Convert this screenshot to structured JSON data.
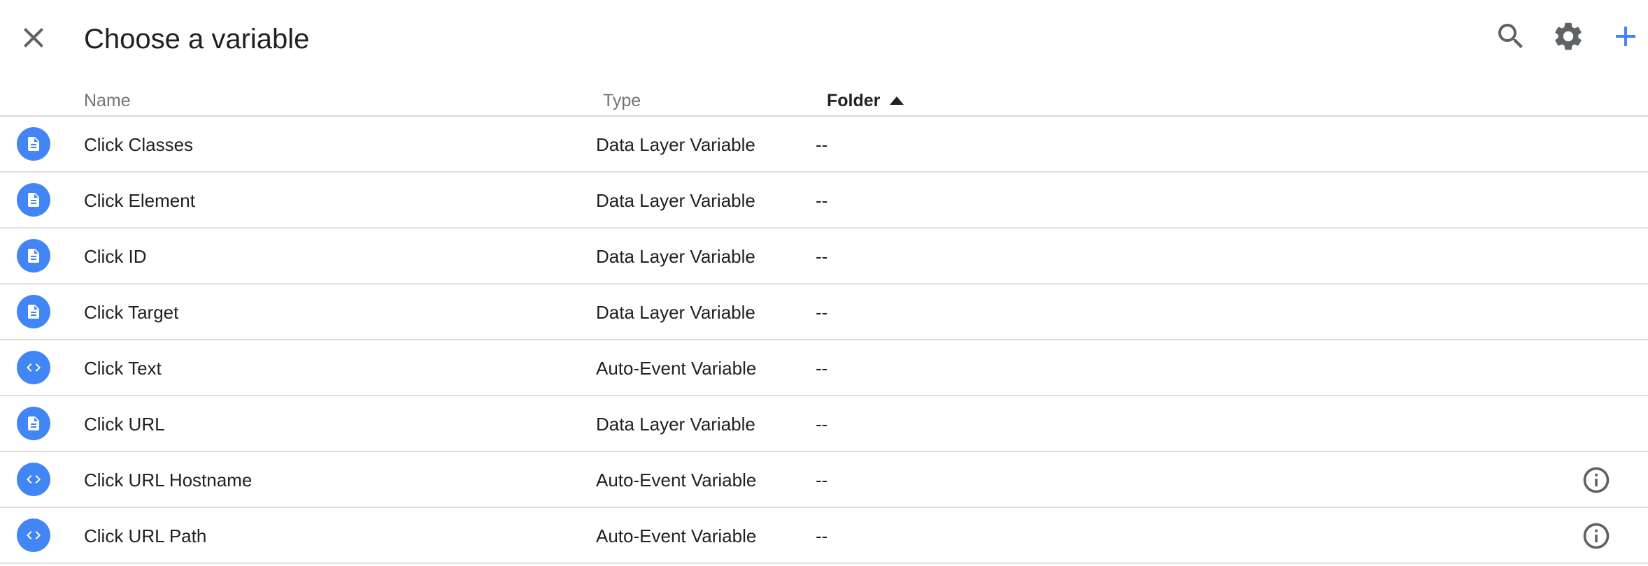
{
  "header": {
    "title": "Choose a variable",
    "icons": [
      "close-icon",
      "search-icon",
      "gear-icon",
      "add-icon"
    ]
  },
  "colors": {
    "accent": "#4285f4",
    "text": "#202124",
    "muted": "#70757a",
    "divider": "#e0e0e0"
  },
  "table": {
    "columns": {
      "name": "Name",
      "type": "Type",
      "folder": "Folder"
    },
    "sort_column": "Folder",
    "sort_direction": "ascending",
    "rows": [
      {
        "name": "Click Classes",
        "type": "Data Layer Variable",
        "folder": "--",
        "icon": "document-icon",
        "info": false
      },
      {
        "name": "Click Element",
        "type": "Data Layer Variable",
        "folder": "--",
        "icon": "document-icon",
        "info": false
      },
      {
        "name": "Click ID",
        "type": "Data Layer Variable",
        "folder": "--",
        "icon": "document-icon",
        "info": false
      },
      {
        "name": "Click Target",
        "type": "Data Layer Variable",
        "folder": "--",
        "icon": "document-icon",
        "info": false
      },
      {
        "name": "Click Text",
        "type": "Auto-Event Variable",
        "folder": "--",
        "icon": "code-icon",
        "info": false
      },
      {
        "name": "Click URL",
        "type": "Data Layer Variable",
        "folder": "--",
        "icon": "document-icon",
        "info": false
      },
      {
        "name": "Click URL Hostname",
        "type": "Auto-Event Variable",
        "folder": "--",
        "icon": "code-icon",
        "info": true
      },
      {
        "name": "Click URL Path",
        "type": "Auto-Event Variable",
        "folder": "--",
        "icon": "code-icon",
        "info": true
      }
    ]
  }
}
